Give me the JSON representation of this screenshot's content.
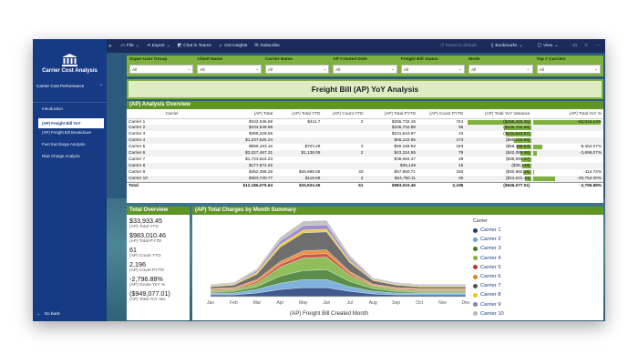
{
  "nav": {
    "app_title": "Carrier Cost Analysis",
    "group_label": "Carrier Cost Performance",
    "pages": [
      "Introduction",
      "(AP) Freight Bill YoY",
      "(AP) Freight Bill Breakdown",
      "Fuel Surcharge Analysis",
      "Raw Charge Analysis"
    ],
    "active_index": 1,
    "go_back": "Go back"
  },
  "toolbar": {
    "file": "File",
    "export": "Export",
    "chat": "Chat in Teams",
    "insights": "Get insights",
    "subscribe": "Subscribe",
    "reset": "Reset to default",
    "bookmarks": "Bookmarks",
    "view": "View"
  },
  "slicers": [
    {
      "label": "Super User Group",
      "value": "All"
    },
    {
      "label": "Client Name",
      "value": "All"
    },
    {
      "label": "Carrier Name",
      "value": "All"
    },
    {
      "label": "AP Created Date",
      "value": "All"
    },
    {
      "label": "Freight Bill Status",
      "value": "All"
    },
    {
      "label": "Mode",
      "value": "All"
    },
    {
      "label": "Top # Carriers",
      "value": "All"
    }
  ],
  "report_title": "Freight Bill (AP) YoY Analysis",
  "yoy_table": {
    "title": "(AP) Analysis Overview",
    "columns": [
      "Carrier",
      "(AP) Total",
      "(AP) Total YTD",
      "(AP) Count YTD",
      "(AP) Total PYTD",
      "(AP) Count PYTD",
      "(AP) Total YoY Variance",
      "(AP) Total YoY %"
    ],
    "rows": [
      {
        "carrier": "Carrier 1",
        "total": "$342,046.69",
        "ytd": "$411.7",
        "count_ytd": "2",
        "pytd": "$255,732.15",
        "count_pytd": "744",
        "variance": "($255,320.45)",
        "var_bar": 1.0,
        "pct": "-62,016.14%",
        "pct_bar": 1.0
      },
      {
        "carrier": "Carrier 2",
        "total": "$434,549.99",
        "ytd": "",
        "count_ytd": "",
        "pytd": "$106,702.88",
        "count_pytd": "95",
        "variance": "($106,702.88)",
        "var_bar": 0.42,
        "pct": "",
        "pct_bar": 0
      },
      {
        "carrier": "Carrier 3",
        "total": "$399,228.55",
        "ytd": "",
        "count_ytd": "",
        "pytd": "$101,543.97",
        "count_pytd": "43",
        "variance": "($101,543.97)",
        "var_bar": 0.4,
        "pct": "",
        "pct_bar": 0
      },
      {
        "carrier": "Carrier 4",
        "total": "$1,237,525.24",
        "ytd": "",
        "count_ytd": "",
        "pytd": "$66,122.95",
        "count_pytd": "173",
        "variance": "($66,122.95)",
        "var_bar": 0.26,
        "pct": "",
        "pct_bar": 0
      },
      {
        "carrier": "Carrier 5",
        "total": "$999,163.16",
        "ytd": "$703.29",
        "count_ytd": "3",
        "pytd": "$60,159.93",
        "count_pytd": "183",
        "variance": "($59,456.64)",
        "var_bar": 0.23,
        "pct": "-8,454.07%",
        "pct_bar": 0.14
      },
      {
        "carrier": "Carrier 6",
        "total": "$2,027,497.31",
        "ytd": "$1,138.09",
        "count_ytd": "2",
        "pytd": "$43,224.55",
        "count_pytd": "79",
        "variance": "($42,086.46)",
        "var_bar": 0.17,
        "pct": "-3,698.07%",
        "pct_bar": 0.06
      },
      {
        "carrier": "Carrier 7",
        "total": "$1,723,616.23",
        "ytd": "",
        "count_ytd": "",
        "pytd": "$38,694.47",
        "count_pytd": "29",
        "variance": "($38,694.47)",
        "var_bar": 0.15,
        "pct": "",
        "pct_bar": 0
      },
      {
        "carrier": "Carrier 8",
        "total": "$177,872.26",
        "ytd": "",
        "count_ytd": "",
        "pytd": "$35,149",
        "count_pytd": "15",
        "variance": "($35,149)",
        "var_bar": 0.14,
        "pct": "",
        "pct_bar": 0
      },
      {
        "carrier": "Carrier 9",
        "total": "$452,398.29",
        "ytd": "$26,988.55",
        "count_ytd": "40",
        "pytd": "$57,950.71",
        "count_pytd": "150",
        "variance": "($30,962.16)",
        "var_bar": 0.12,
        "pct": "-114.72%",
        "pct_bar": 0.01
      },
      {
        "carrier": "Carrier 10",
        "total": "$363,740.77",
        "ytd": "$118.68",
        "count_ytd": "2",
        "pytd": "$24,750.11",
        "count_pytd": "26",
        "variance": "($24,631.43)",
        "var_bar": 0.1,
        "pct": "-20,754.00%",
        "pct_bar": 0.33
      }
    ],
    "total_row": {
      "carrier": "Total",
      "total": "$12,185,075.64",
      "ytd": "$33,933.45",
      "count_ytd": "61",
      "pytd": "$983,010.46",
      "count_pytd": "2,196",
      "variance": "($949,077.01)",
      "pct": "-2,796.88%"
    }
  },
  "overview": {
    "title": "Total Overview",
    "kpis": [
      {
        "value": "$33,933.45",
        "label": "(AP) Total YTD"
      },
      {
        "value": "$983,010.46",
        "label": "(AP) Total PYTD"
      },
      {
        "value": "61",
        "label": "(AP) Count YTD"
      },
      {
        "value": "2,196",
        "label": "(AP) Count PYTD"
      },
      {
        "value": "-2,796.88%",
        "label": "(AP) Gross YoY %"
      },
      {
        "value": "($949,077.01)",
        "label": "(AP) Total YoY Var."
      }
    ]
  },
  "chart_data": {
    "type": "area",
    "title": "(AP) Total Charges by Month Summary",
    "xlabel": "(AP) Freight Bill Created Month",
    "categories": [
      "Jan",
      "Feb",
      "Mar",
      "Apr",
      "May",
      "Jun",
      "Jul",
      "Aug",
      "Sep",
      "Oct",
      "Nov",
      "Dec"
    ],
    "legend_title": "Carrier",
    "legend_position": "right",
    "stacked": true,
    "series": [
      {
        "name": "Carrier 1",
        "color": "#1f3d7a",
        "values": [
          2,
          2,
          4,
          8,
          10,
          10,
          6,
          3,
          2,
          2,
          2,
          2
        ]
      },
      {
        "name": "Carrier 2",
        "color": "#6aa5d8",
        "values": [
          2,
          2,
          4,
          7,
          9,
          9,
          5,
          3,
          2,
          2,
          2,
          2
        ]
      },
      {
        "name": "Carrier 3",
        "color": "#3d7a2a",
        "values": [
          1,
          2,
          3,
          8,
          10,
          11,
          6,
          3,
          2,
          1,
          1,
          1
        ]
      },
      {
        "name": "Carrier 4",
        "color": "#7eb13d",
        "values": [
          2,
          2,
          4,
          10,
          14,
          14,
          7,
          3,
          2,
          2,
          2,
          2
        ]
      },
      {
        "name": "Carrier 5",
        "color": "#c0392b",
        "values": [
          1,
          1,
          2,
          3,
          4,
          4,
          2,
          1,
          1,
          1,
          1,
          1
        ]
      },
      {
        "name": "Carrier 6",
        "color": "#e67e22",
        "values": [
          1,
          1,
          2,
          3,
          4,
          4,
          2,
          1,
          1,
          1,
          1,
          1
        ]
      },
      {
        "name": "Carrier 7",
        "color": "#555555",
        "values": [
          2,
          3,
          6,
          16,
          20,
          20,
          10,
          4,
          3,
          2,
          2,
          2
        ]
      },
      {
        "name": "Carrier 8",
        "color": "#f1c40f",
        "values": [
          1,
          1,
          2,
          3,
          3,
          3,
          2,
          1,
          1,
          1,
          1,
          1
        ]
      },
      {
        "name": "Carrier 9",
        "color": "#8e7cc3",
        "values": [
          1,
          1,
          2,
          4,
          5,
          5,
          3,
          1,
          1,
          1,
          1,
          1
        ]
      },
      {
        "name": "Carrier 10",
        "color": "#b8b8b8",
        "values": [
          1,
          1,
          2,
          4,
          5,
          5,
          3,
          1,
          1,
          1,
          1,
          1
        ]
      }
    ]
  }
}
